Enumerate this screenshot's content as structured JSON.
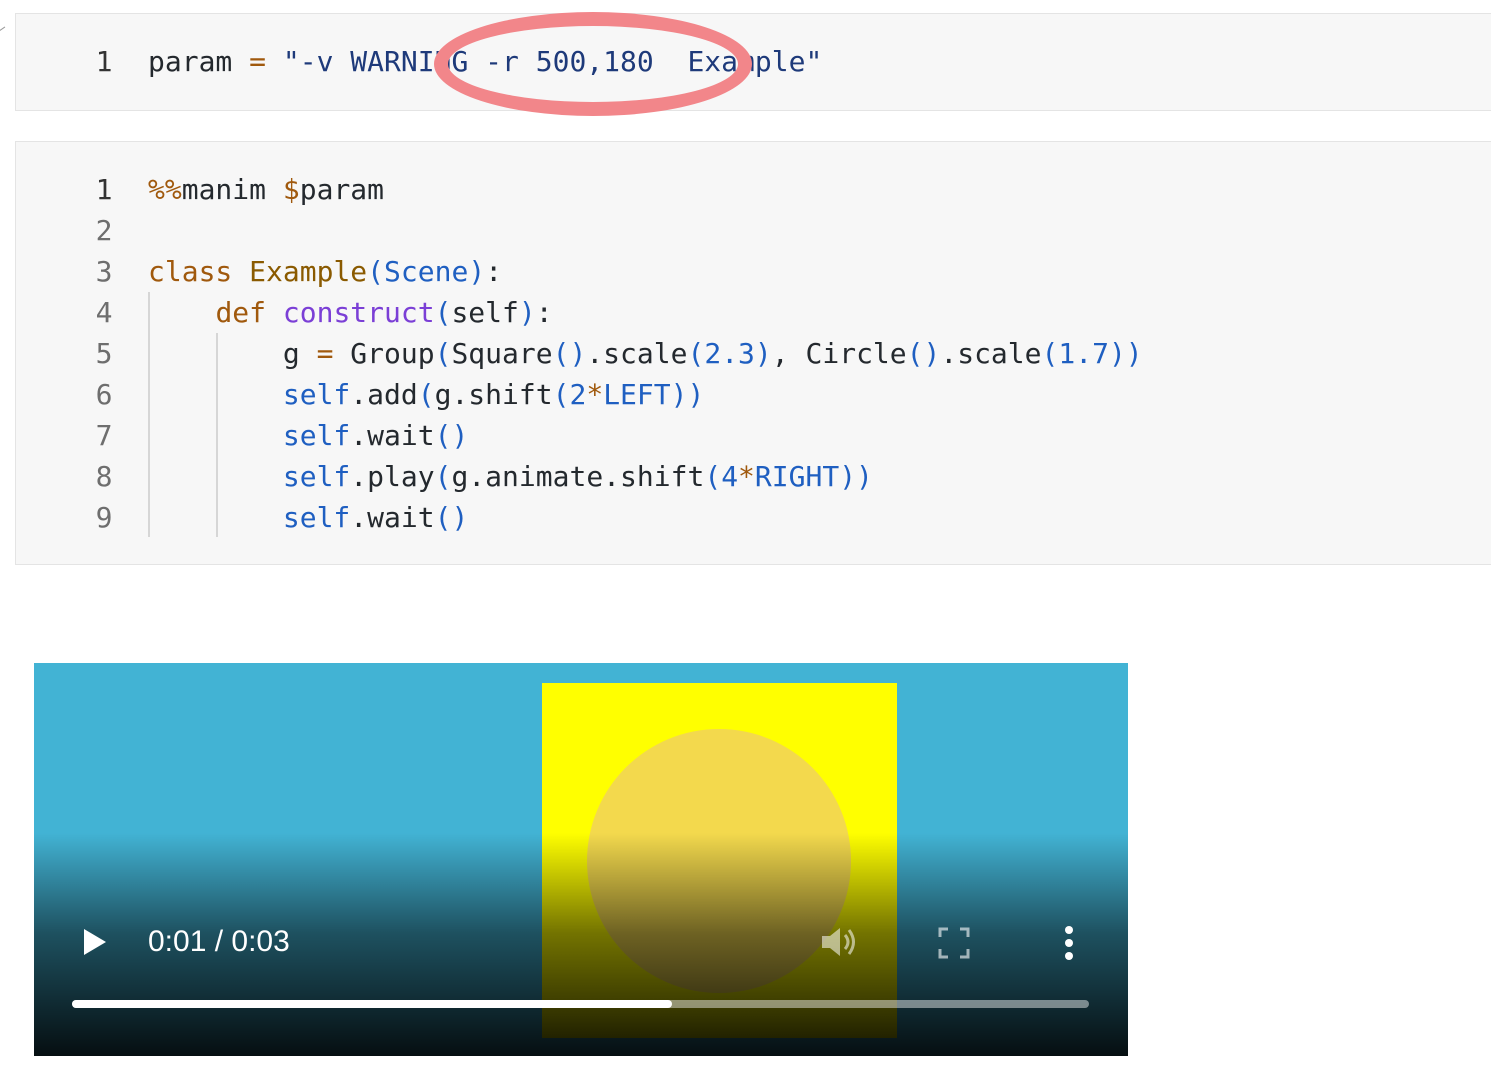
{
  "cell1": {
    "line_numbers": [
      "1"
    ],
    "lines": [
      {
        "tokens": [
          {
            "t": "param",
            "c": "name"
          },
          {
            "t": " = ",
            "c": "op"
          },
          {
            "t": "\"-v WARNING -r 500,180  Example\"",
            "c": "str"
          }
        ]
      }
    ]
  },
  "cell2": {
    "line_numbers": [
      "1",
      "2",
      "3",
      "4",
      "5",
      "6",
      "7",
      "8",
      "9"
    ],
    "lines": [
      {
        "tokens": [
          {
            "t": "%%",
            "c": "op"
          },
          {
            "t": "manim ",
            "c": "name"
          },
          {
            "t": "$",
            "c": "op"
          },
          {
            "t": "param",
            "c": "name"
          }
        ]
      },
      {
        "tokens": []
      },
      {
        "tokens": [
          {
            "t": "class ",
            "c": "kw"
          },
          {
            "t": "Example",
            "c": "cls"
          },
          {
            "t": "(",
            "c": "blue"
          },
          {
            "t": "Scene",
            "c": "blue"
          },
          {
            "t": ")",
            "c": "blue"
          },
          {
            "t": ":",
            "c": "name"
          }
        ]
      },
      {
        "tokens": [
          {
            "t": "    ",
            "c": "name"
          },
          {
            "t": "def ",
            "c": "kw"
          },
          {
            "t": "construct",
            "c": "fn"
          },
          {
            "t": "(",
            "c": "blue"
          },
          {
            "t": "self",
            "c": "name"
          },
          {
            "t": ")",
            "c": "blue"
          },
          {
            "t": ":",
            "c": "name"
          }
        ]
      },
      {
        "tokens": [
          {
            "t": "        g ",
            "c": "name"
          },
          {
            "t": "=",
            "c": "op"
          },
          {
            "t": " Group",
            "c": "name"
          },
          {
            "t": "(",
            "c": "blue"
          },
          {
            "t": "Square",
            "c": "name"
          },
          {
            "t": "()",
            "c": "blue"
          },
          {
            "t": ".scale",
            "c": "name"
          },
          {
            "t": "(",
            "c": "blue"
          },
          {
            "t": "2.3",
            "c": "num"
          },
          {
            "t": ")",
            "c": "blue"
          },
          {
            "t": ", Circle",
            "c": "name"
          },
          {
            "t": "()",
            "c": "blue"
          },
          {
            "t": ".scale",
            "c": "name"
          },
          {
            "t": "(",
            "c": "blue"
          },
          {
            "t": "1.7",
            "c": "num"
          },
          {
            "t": "))",
            "c": "blue"
          }
        ]
      },
      {
        "tokens": [
          {
            "t": "        ",
            "c": "name"
          },
          {
            "t": "self",
            "c": "blue"
          },
          {
            "t": ".add",
            "c": "name"
          },
          {
            "t": "(",
            "c": "blue"
          },
          {
            "t": "g.shift",
            "c": "name"
          },
          {
            "t": "(",
            "c": "blue"
          },
          {
            "t": "2",
            "c": "num"
          },
          {
            "t": "*",
            "c": "op"
          },
          {
            "t": "LEFT",
            "c": "blue"
          },
          {
            "t": "))",
            "c": "blue"
          }
        ]
      },
      {
        "tokens": [
          {
            "t": "        ",
            "c": "name"
          },
          {
            "t": "self",
            "c": "blue"
          },
          {
            "t": ".wait",
            "c": "name"
          },
          {
            "t": "()",
            "c": "blue"
          }
        ]
      },
      {
        "tokens": [
          {
            "t": "        ",
            "c": "name"
          },
          {
            "t": "self",
            "c": "blue"
          },
          {
            "t": ".play",
            "c": "name"
          },
          {
            "t": "(",
            "c": "blue"
          },
          {
            "t": "g.animate.shift",
            "c": "name"
          },
          {
            "t": "(",
            "c": "blue"
          },
          {
            "t": "4",
            "c": "num"
          },
          {
            "t": "*",
            "c": "op"
          },
          {
            "t": "RIGHT",
            "c": "blue"
          },
          {
            "t": "))",
            "c": "blue"
          }
        ]
      },
      {
        "tokens": [
          {
            "t": "        ",
            "c": "name"
          },
          {
            "t": "self",
            "c": "blue"
          },
          {
            "t": ".wait",
            "c": "name"
          },
          {
            "t": "()",
            "c": "blue"
          }
        ]
      }
    ]
  },
  "video": {
    "time": "0:01 / 0:03",
    "progress": 0.59,
    "background_color": "#42b3d4",
    "square_color": "#ffff00",
    "circle_color": "#f3d94d",
    "icons": [
      "play-icon",
      "volume-icon",
      "fullscreen-icon",
      "more-vert-icon"
    ]
  },
  "annotation": {
    "color": "#f2868a",
    "shape": "ellipse"
  }
}
